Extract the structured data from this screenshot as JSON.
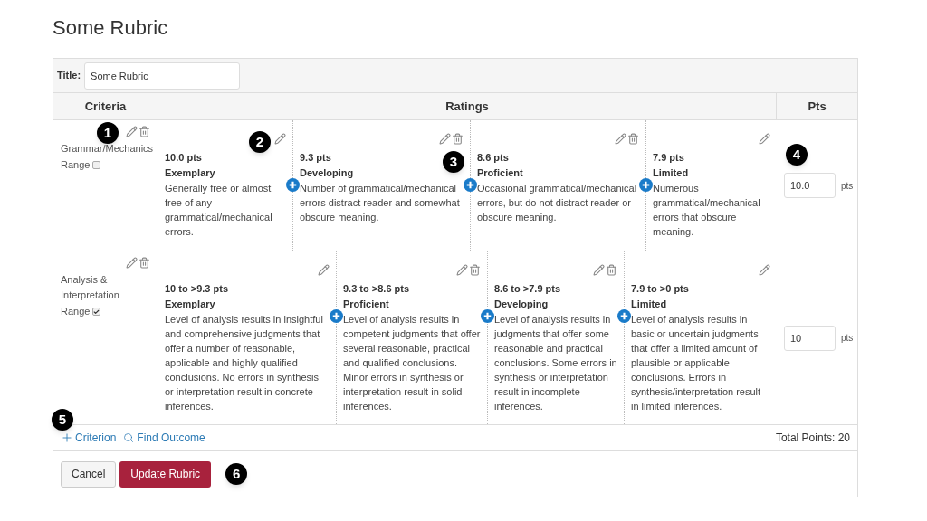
{
  "page_title": "Some Rubric",
  "title_field": {
    "label": "Title:",
    "value": "Some Rubric"
  },
  "columns": [
    "Criteria",
    "Ratings",
    "Pts"
  ],
  "criteria": [
    {
      "name": "Grammar/Mechanics",
      "range_label": "Range",
      "range": false,
      "callout": "1",
      "points": "10.0",
      "points_unit": "pts",
      "points_callout": "4",
      "ratings": [
        {
          "points": "10.0 pts",
          "title": "Exemplary",
          "description": "Generally free or almost free of any grammatical/mechanical errors.",
          "deletable": false,
          "callout": "2"
        },
        {
          "points": "9.3 pts",
          "title": "Developing",
          "description": "Number of grammatical/mechanical errors distract reader and somewhat obscure meaning.",
          "deletable": true,
          "callout": "3"
        },
        {
          "points": "8.6 pts",
          "title": "Proficient",
          "description": "Occasional grammatical/mechanical errors, but do not distract reader or obscure meaning.",
          "deletable": true
        },
        {
          "points": "7.9 pts",
          "title": "Limited",
          "description": "Numerous grammatical/mechanical errors that obscure meaning.",
          "deletable": false
        }
      ]
    },
    {
      "name": "Analysis & Interpretation",
      "range_label": "Range",
      "range": true,
      "points": "10",
      "points_unit": "pts",
      "ratings": [
        {
          "points": "10 to >9.3 pts",
          "title": "Exemplary",
          "description": "Level of analysis results in insightful and comprehensive judgments that offer a number of reasonable, applicable and highly qualified conclusions. No errors in synthesis or interpretation result in concrete inferences.",
          "deletable": false
        },
        {
          "points": "9.3 to >8.6 pts",
          "title": "Proficient",
          "description": "Level of analysis results in competent judgments that offer several reasonable, practical and qualified conclusions. Minor errors in synthesis or interpretation result in solid inferences.",
          "deletable": true
        },
        {
          "points": "8.6 to >7.9 pts",
          "title": "Developing",
          "description": "Level of analysis results in judgments that offer some reasonable and practical conclusions. Some errors in synthesis or interpretation result in incomplete inferences.",
          "deletable": true
        },
        {
          "points": "7.9 to >0 pts",
          "title": "Limited",
          "description": "Level of analysis results in basic or uncertain judgments that offer a limited amount of plausible or applicable conclusions. Errors in synthesis/interpretation result in limited inferences.",
          "deletable": false
        }
      ]
    }
  ],
  "footer": {
    "add_criterion": "Criterion",
    "find_outcome": "Find Outcome",
    "total": "Total Points: 20",
    "callout": "5"
  },
  "buttons": {
    "cancel": "Cancel",
    "submit": "Update Rubric",
    "callout": "6"
  }
}
